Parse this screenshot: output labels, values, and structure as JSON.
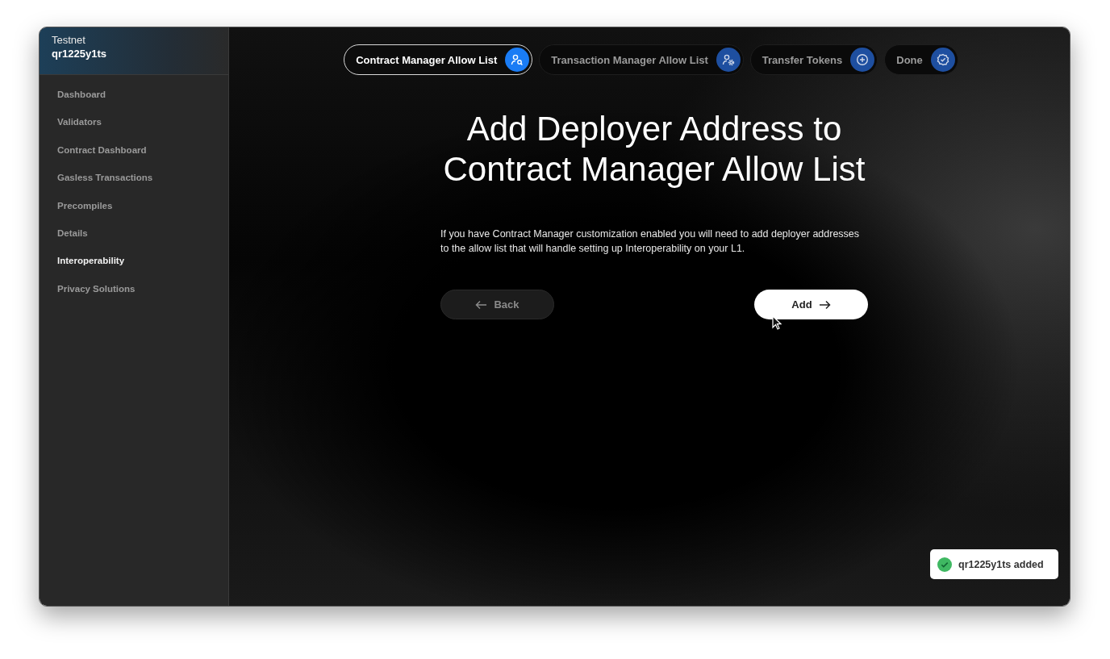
{
  "sidebar": {
    "network": "Testnet",
    "chain": "qr1225y1ts",
    "items": [
      {
        "label": "Dashboard",
        "selected": false
      },
      {
        "label": "Validators",
        "selected": false
      },
      {
        "label": "Contract Dashboard",
        "selected": false
      },
      {
        "label": "Gasless Transactions",
        "selected": false
      },
      {
        "label": "Precompiles",
        "selected": false
      },
      {
        "label": "Details",
        "selected": false
      },
      {
        "label": "Interoperability",
        "selected": true
      },
      {
        "label": "Privacy Solutions",
        "selected": false
      }
    ]
  },
  "steps": [
    {
      "label": "Contract Manager Allow List",
      "selected": true
    },
    {
      "label": "Transaction Manager Allow List",
      "selected": false
    },
    {
      "label": "Transfer Tokens",
      "selected": false
    },
    {
      "label": "Done",
      "selected": false
    }
  ],
  "title": "Add Deployer Address to Contract Manager Allow List",
  "description": "If you have Contract Manager customization enabled you will need to add deployer addresses to the allow list that will handle setting up Interoperability on your L1.",
  "buttons": {
    "back": "Back",
    "add": "Add"
  },
  "toast": {
    "message": "qr1225y1ts added"
  }
}
